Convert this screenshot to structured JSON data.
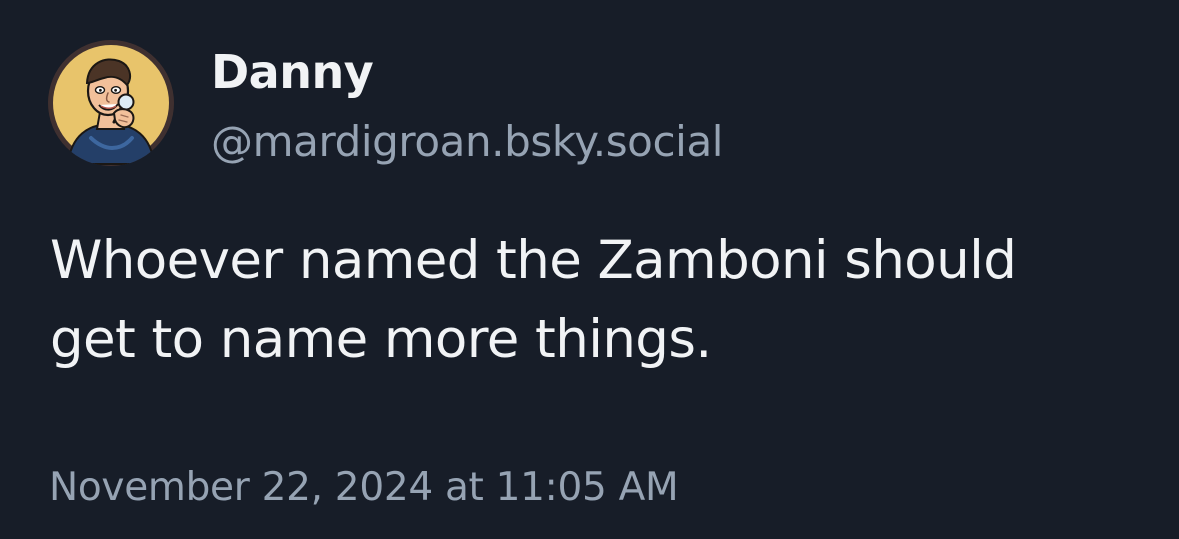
{
  "author": {
    "display_name": "Danny",
    "handle": "@mardigroan.bsky.social",
    "avatar_icon": "cartoon-avatar-icon"
  },
  "post": {
    "lines": [
      "Whoever named the Zamboni should",
      "get to name more things."
    ]
  },
  "timestamp": "November 22, 2024 at 11:05 AM",
  "colors": {
    "background": "#171d28",
    "primary_text": "#f1f3f5",
    "secondary_text": "#96a3b3",
    "avatar_background": "#e8c46b"
  }
}
